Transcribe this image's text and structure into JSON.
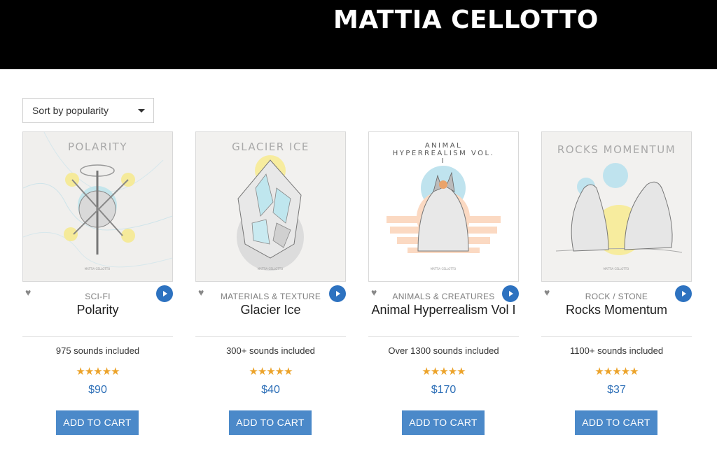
{
  "header": {
    "title": "MATTIA CELLOTTO"
  },
  "sort": {
    "selected": "Sort by popularity"
  },
  "products": [
    {
      "art_title": "POLARITY",
      "category": "SCI-FI",
      "name": "Polarity",
      "sounds": "975 sounds included",
      "rating": "★★★★★",
      "price": "$90",
      "cart_label": "ADD TO CART"
    },
    {
      "art_title": "GLACIER ICE",
      "category": "MATERIALS & TEXTURE",
      "name": "Glacier Ice",
      "sounds": "300+ sounds included",
      "rating": "★★★★★",
      "price": "$40",
      "cart_label": "ADD TO CART"
    },
    {
      "art_title": "ANIMAL HYPERREALISM VOL. I",
      "category": "ANIMALS & CREATURES",
      "name": "Animal Hyperrealism Vol I",
      "sounds": "Over 1300 sounds included",
      "rating": "★★★★★",
      "price": "$170",
      "cart_label": "ADD TO CART"
    },
    {
      "art_title": "ROCKS MOMENTUM",
      "category": "ROCK / STONE",
      "name": "Rocks Momentum",
      "sounds": "1100+ sounds included",
      "rating": "★★★★★",
      "price": "$37",
      "cart_label": "ADD TO CART"
    }
  ],
  "icons": {
    "wishlist": "heart-icon",
    "preview": "play-icon",
    "sort": "caret-down-icon"
  },
  "colors": {
    "header_bg": "#000000",
    "accent": "#4b89c9",
    "price": "#2d6fb7",
    "stars": "#eca32a"
  }
}
